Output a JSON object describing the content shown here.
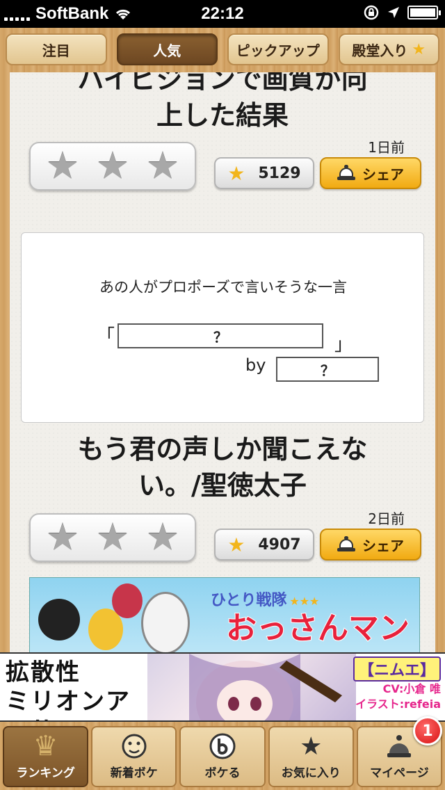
{
  "status_bar": {
    "carrier": "SoftBank",
    "time": "22:12",
    "icons": [
      "wifi-icon",
      "rotation-lock-icon",
      "location-icon",
      "battery-icon"
    ]
  },
  "top_tabs": [
    {
      "label": "注目",
      "active": false
    },
    {
      "label": "人気",
      "active": true
    },
    {
      "label": "ピックアップ",
      "active": false
    },
    {
      "label": "殿堂入り",
      "active": false,
      "icon": "star-icon"
    }
  ],
  "posts": [
    {
      "title_line1": "ハイビジョンで画質が向",
      "title_line2": "上した結果",
      "date": "1日前",
      "stars": 3,
      "count": "5129",
      "share_label": "シェア"
    },
    {
      "title_line1": "もう君の声しか聞こえな",
      "title_line2": "い。/聖徳太子",
      "date": "2日前",
      "stars": 3,
      "count": "4907",
      "share_label": "シェア"
    }
  ],
  "boke_image": {
    "prompt": "あの人がプロポーズで言いそうな一言",
    "open_bracket": "「",
    "close_bracket": "」",
    "answer_placeholder": "？",
    "by_label": "by",
    "by_placeholder": "？"
  },
  "ad_illustration": {
    "subtitle": "ひとり戦隊",
    "subtitle_stars": "★★★",
    "title": "おっさんマン"
  },
  "banner_ad": {
    "title_line1": "拡散性",
    "title_line2": "ミリオンアーサー",
    "tag": "【ニムエ】",
    "cv": "CV:小倉 唯",
    "illust": "イラスト:refeia"
  },
  "bottom_tabs": [
    {
      "label": "ランキング",
      "icon": "crown-icon",
      "active": true
    },
    {
      "label": "新着ボケ",
      "icon": "face-icon",
      "active": false
    },
    {
      "label": "ボケる",
      "icon": "bokete-logo-icon",
      "active": false
    },
    {
      "label": "お気に入り",
      "icon": "star-icon",
      "active": false
    },
    {
      "label": "マイページ",
      "icon": "bell-icon",
      "active": false,
      "badge": "1"
    }
  ],
  "colors": {
    "wood": "#c99a5e",
    "share_button": "#f1aa12",
    "star_gold": "#f2b51c",
    "badge_red": "#d81010"
  }
}
